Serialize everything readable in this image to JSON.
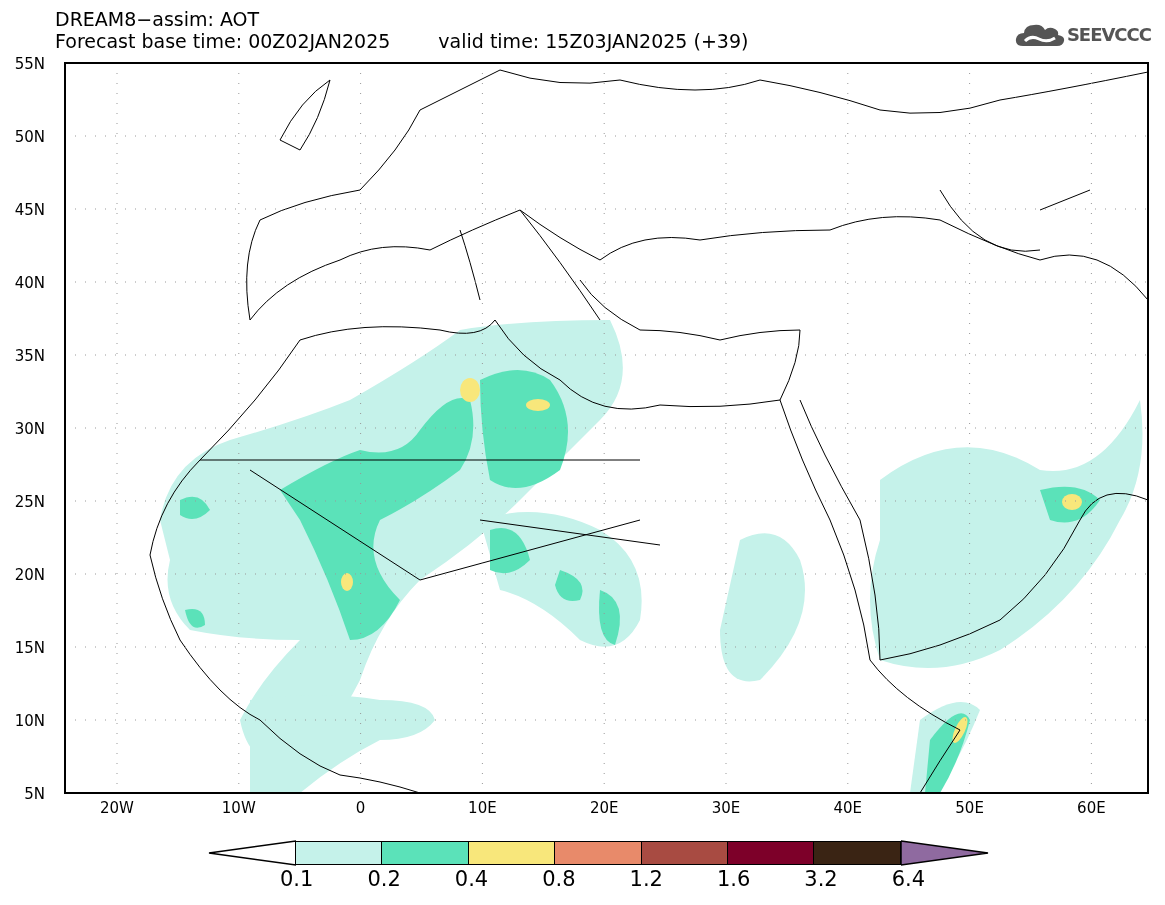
{
  "title": "DREAM8−assim: AOT",
  "forecast_base": "Forecast base time: 00Z02JAN2025",
  "valid_time": "valid time: 15Z03JAN2025 (+39)",
  "logo": {
    "text": "SEEVCCC"
  },
  "map": {
    "lat_labels": [
      "55N",
      "50N",
      "45N",
      "40N",
      "35N",
      "30N",
      "25N",
      "20N",
      "15N",
      "10N",
      "5N"
    ],
    "lon_labels": [
      "20W",
      "10W",
      "0",
      "10E",
      "20E",
      "30E",
      "40E",
      "50E",
      "60E"
    ]
  },
  "colorbar": {
    "bins": [
      {
        "kind": "lower-arrow"
      },
      {
        "kind": "bin",
        "color": "#c5f2ea"
      },
      {
        "kind": "bin",
        "color": "#5be2b9"
      },
      {
        "kind": "bin",
        "color": "#f8e77b"
      },
      {
        "kind": "bin",
        "color": "#e88a6a"
      },
      {
        "kind": "bin",
        "color": "#a84b42"
      },
      {
        "kind": "bin",
        "color": "#7d0029"
      },
      {
        "kind": "bin",
        "color": "#3a2414"
      },
      {
        "kind": "upper-arrow",
        "color": "#8f6aa0"
      }
    ],
    "labels": [
      "0.1",
      "0.2",
      "0.4",
      "0.8",
      "1.2",
      "1.6",
      "3.2",
      "6.4"
    ]
  }
}
